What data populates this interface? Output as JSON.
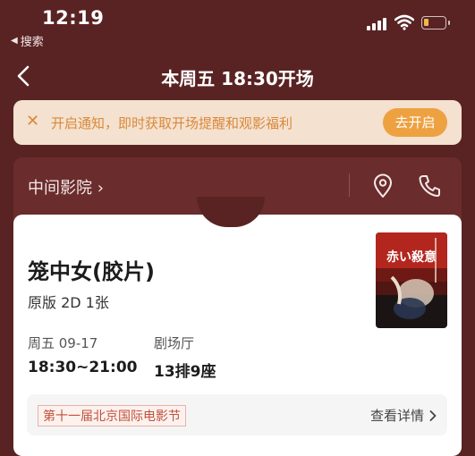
{
  "status_bar": {
    "time": "12:19",
    "back_app_label": "搜索"
  },
  "nav": {
    "title": "本周五 18:30开场"
  },
  "notice": {
    "text": "开启通知，即时获取开场提醒和观影福利",
    "button_label": "去开启"
  },
  "cinema": {
    "name": "中间影院 ›"
  },
  "ticket": {
    "film_title": "笼中女(胶片)",
    "format": "原版 2D 1张",
    "date_label": "周五 09-17",
    "time_range": "18:30~21:00",
    "hall_label": "剧场厅",
    "seat": "13排9座",
    "poster_text": "赤い殺意",
    "festival_tag": "第十一届北京国际电影节",
    "details_link": "查看详情"
  },
  "colors": {
    "background": "#5a2323",
    "accent": "#eea140",
    "notice_bg": "#f4e1cf",
    "notice_text": "#d9893b",
    "festival_tag": "#c0523c"
  },
  "icons": [
    "back-chevron-icon",
    "signal-icon",
    "wifi-icon",
    "battery-icon",
    "close-icon",
    "location-pin-icon",
    "phone-icon",
    "chevron-right-icon"
  ]
}
